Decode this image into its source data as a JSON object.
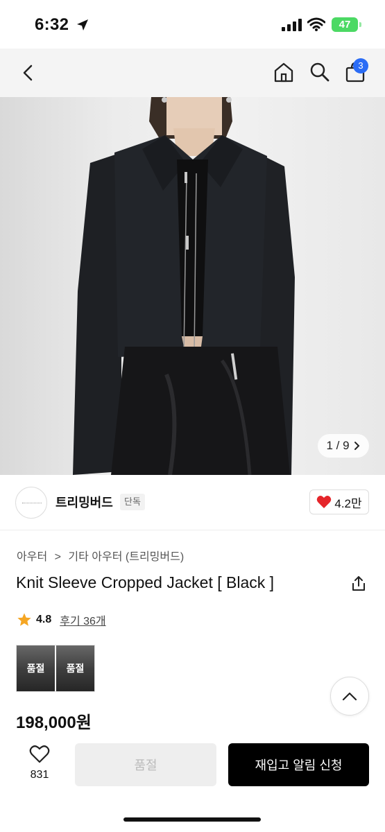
{
  "status_bar": {
    "time": "6:32",
    "battery": "47"
  },
  "nav": {
    "cart_count": "3"
  },
  "gallery": {
    "counter": "1 / 9"
  },
  "brand": {
    "name": "트리밍버드",
    "badge": "단독",
    "likes": "4.2만"
  },
  "breadcrumb": {
    "level1": "아우터",
    "separator": ">",
    "level2": "기타 아우터 (트리밍버드)"
  },
  "product": {
    "title": "Knit Sleeve Cropped Jacket [ Black ]",
    "rating": "4.8",
    "reviews": "후기 36개",
    "price": "198,000원"
  },
  "options": [
    {
      "label": "품절"
    },
    {
      "label": "품절"
    }
  ],
  "bottom_bar": {
    "wish_count": "831",
    "soldout_label": "품절",
    "restock_label": "재입고 알림 신청"
  },
  "colors": {
    "accent_blue": "#2b6cf5",
    "heart_red": "#e5252a",
    "star": "#f5a623",
    "battery_green": "#4cd964"
  },
  "icons": [
    "location-arrow-icon",
    "signal-icon",
    "wifi-icon",
    "back-icon",
    "home-icon",
    "search-icon",
    "cart-icon",
    "chevron-right-icon",
    "heart-icon",
    "share-icon",
    "star-icon",
    "chevron-up-icon",
    "heart-outline-icon"
  ]
}
